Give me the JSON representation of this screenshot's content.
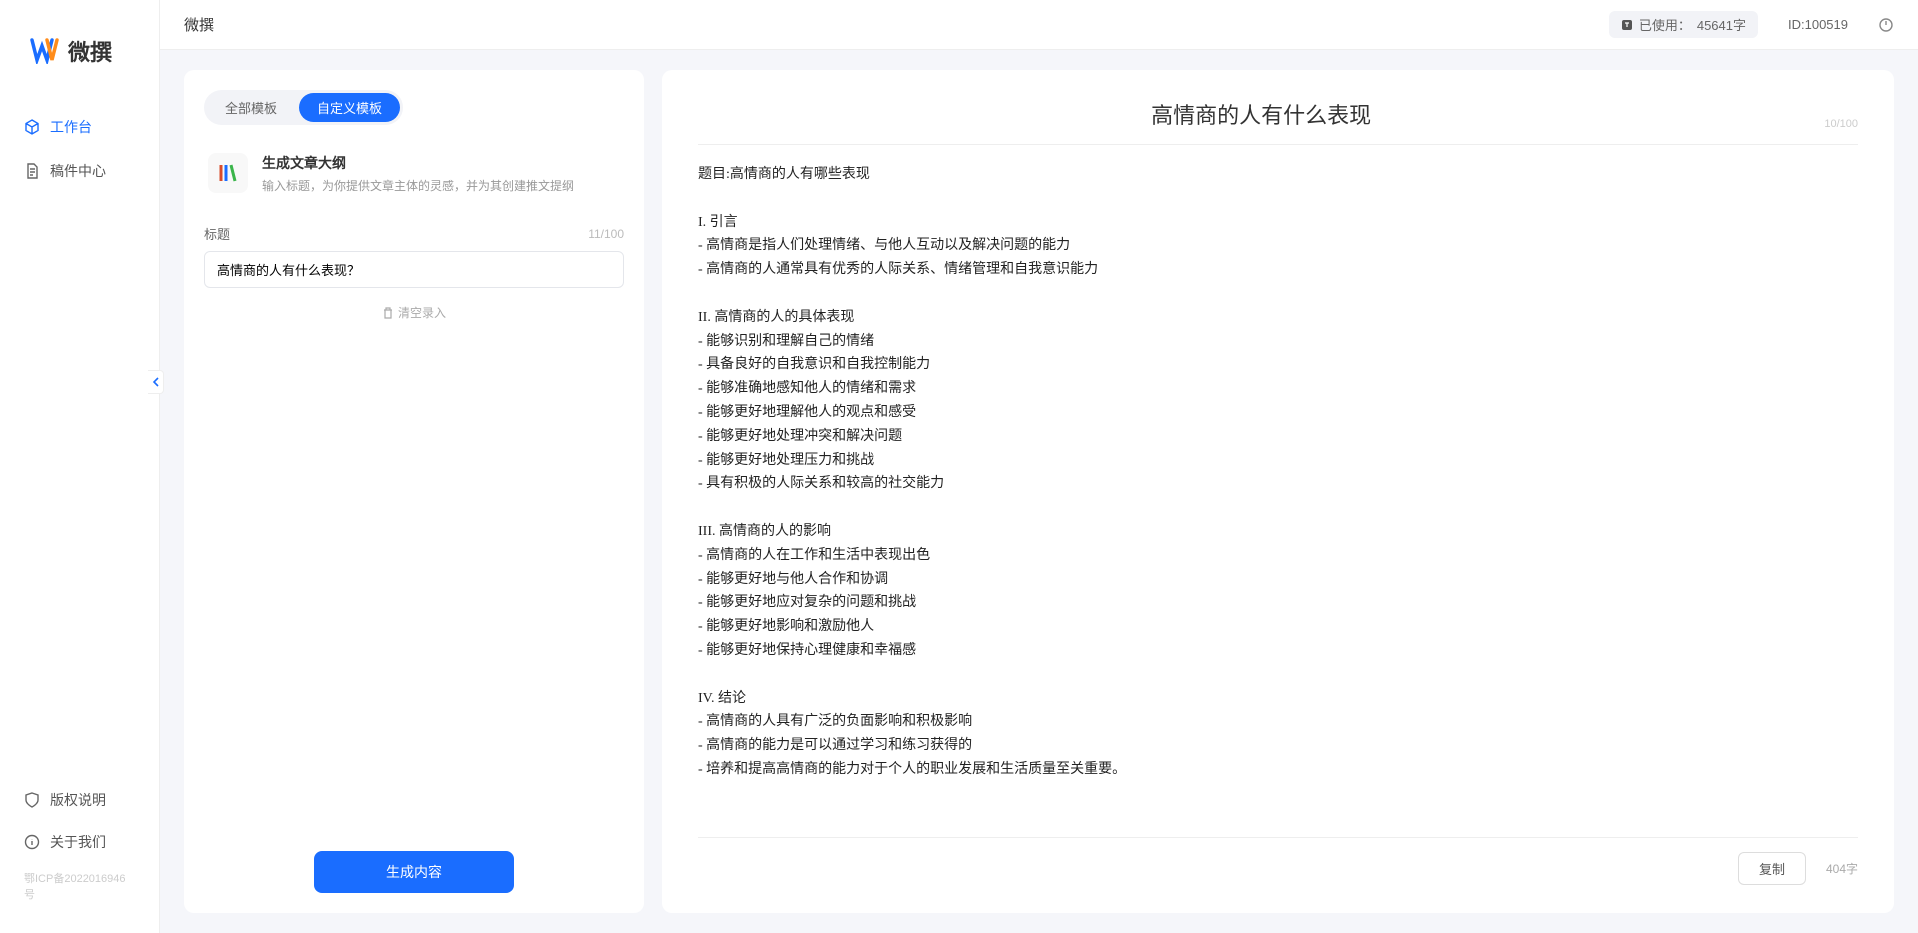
{
  "app": {
    "brand": "微撰",
    "topbar_title": "微撰",
    "usage_label": "已使用：",
    "usage_value": "45641字",
    "user_id_label": "ID:100519",
    "icp": "鄂ICP备2022016946号"
  },
  "sidebar": {
    "items": [
      {
        "label": "工作台",
        "icon": "cube-icon",
        "active": true
      },
      {
        "label": "稿件中心",
        "icon": "doc-icon",
        "active": false
      }
    ],
    "bottom": [
      {
        "label": "版权说明",
        "icon": "shield-icon"
      },
      {
        "label": "关于我们",
        "icon": "info-icon"
      }
    ]
  },
  "left": {
    "tabs": [
      {
        "label": "全部模板",
        "active": false
      },
      {
        "label": "自定义模板",
        "active": true
      }
    ],
    "template": {
      "title": "生成文章大纲",
      "desc": "输入标题，为你提供文章主体的灵感，并为其创建推文提纲"
    },
    "field": {
      "label": "标题",
      "count": "11/100",
      "value": "高情商的人有什么表现？"
    },
    "clear": "清空录入",
    "generate": "生成内容"
  },
  "right": {
    "title": "高情商的人有什么表现",
    "title_count": "10/100",
    "body": "题目:高情商的人有哪些表现\n\nI. 引言\n- 高情商是指人们处理情绪、与他人互动以及解决问题的能力\n- 高情商的人通常具有优秀的人际关系、情绪管理和自我意识能力\n\nII. 高情商的人的具体表现\n- 能够识别和理解自己的情绪\n- 具备良好的自我意识和自我控制能力\n- 能够准确地感知他人的情绪和需求\n- 能够更好地理解他人的观点和感受\n- 能够更好地处理冲突和解决问题\n- 能够更好地处理压力和挑战\n- 具有积极的人际关系和较高的社交能力\n\nIII. 高情商的人的影响\n- 高情商的人在工作和生活中表现出色\n- 能够更好地与他人合作和协调\n- 能够更好地应对复杂的问题和挑战\n- 能够更好地影响和激励他人\n- 能够更好地保持心理健康和幸福感\n\nIV. 结论\n- 高情商的人具有广泛的负面影响和积极影响\n- 高情商的能力是可以通过学习和练习获得的\n- 培养和提高高情商的能力对于个人的职业发展和生活质量至关重要。",
    "copy": "复制",
    "word_count": "404字"
  }
}
